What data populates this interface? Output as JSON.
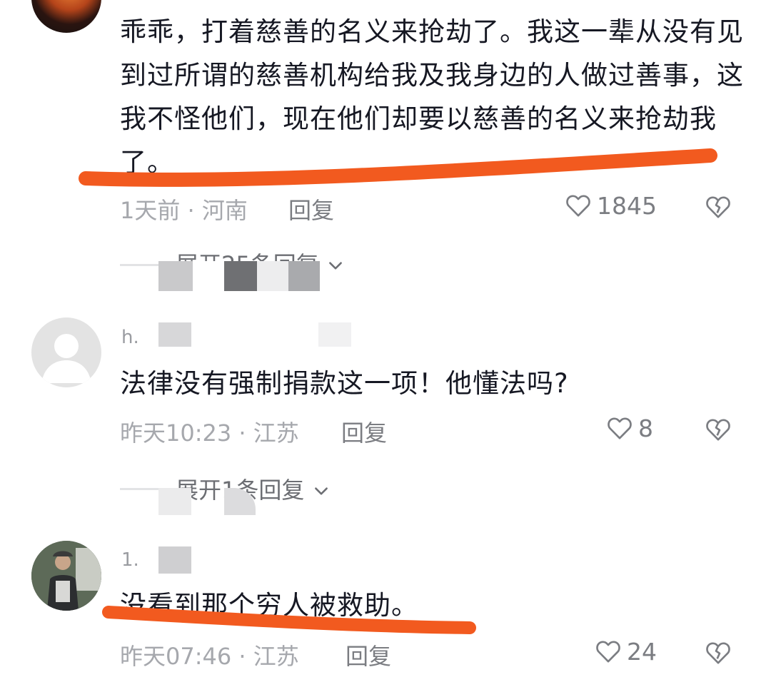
{
  "comments": [
    {
      "username": "",
      "text": "乖乖，打着慈善的名义来抢劫了。我这一辈从没有见到过所谓的慈善机构给我及我身边的人做过善事，这我不怪他们，现在他们却要以慈善的名义来抢劫我了。",
      "time_location": "1天前 · 河南",
      "reply_label": "回复",
      "likes": "1845",
      "expand_label": "展开25条回复"
    },
    {
      "username": "h.",
      "text": "法律没有强制捐款这一项！他懂法吗?",
      "time_location": "昨天10:23 · 江苏",
      "reply_label": "回复",
      "likes": "8",
      "expand_label": "展开1条回复"
    },
    {
      "username": "1.",
      "text": "没看到那个穷人被救助。",
      "time_location": "昨天07:46 · 江苏",
      "reply_label": "回复",
      "likes": "24"
    }
  ],
  "colors": {
    "text": "#161823",
    "meta": "#a6a8ad",
    "highlight_underline": "#f25a1f"
  },
  "icons": [
    "heart-icon",
    "broken-heart-icon",
    "chevron-down-icon"
  ]
}
